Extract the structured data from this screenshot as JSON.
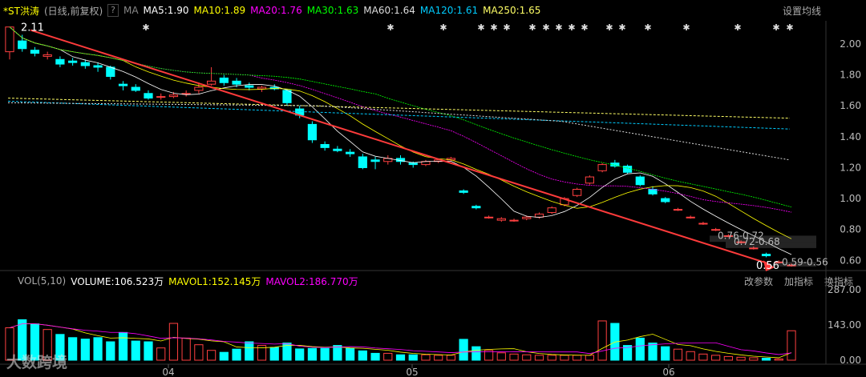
{
  "header": {
    "stock_name": "*ST洪涛",
    "period": "(日线,前复权)",
    "help": "?",
    "ma_label": "MA",
    "ma5": "MA5:1.90",
    "ma10": "MA10:1.89",
    "ma20": "MA20:1.76",
    "ma30": "MA30:1.63",
    "ma60": "MA60:1.64",
    "ma120": "MA120:1.61",
    "ma250": "MA250:1.65",
    "settings": "设置均线",
    "colors": {
      "ma5": "#ffffff",
      "ma10": "#ffff00",
      "ma20": "#ff00ff",
      "ma30": "#00ff00",
      "ma60": "#cccccc",
      "ma120": "#00ccff",
      "ma250": "#ffff66"
    }
  },
  "volume_header": {
    "label": "VOL(5,10)",
    "volume": "VOLUME:106.523万",
    "mavol1": "MAVOL1:152.145万",
    "mavol2": "MAVOL2:186.770万",
    "btn1": "改参数",
    "btn2": "加指标",
    "btn3": "换指标"
  },
  "annotations": {
    "high": "2.11",
    "low": "0.56",
    "label1": "0.76-0.72",
    "label2": "0.72-0.68",
    "label3": "0.59-0.56"
  },
  "watermark": "大数跨境",
  "chart_data": {
    "type": "candlestick",
    "price_ticks": [
      "2.00",
      "1.80",
      "1.60",
      "1.40",
      "1.20",
      "1.00",
      "0.80",
      "0.60"
    ],
    "price_range": [
      0.55,
      2.15
    ],
    "volume_ticks": [
      "287.00",
      "143.00",
      "0.00"
    ],
    "volume_range": [
      0,
      287
    ],
    "x_ticks": [
      "04",
      "05",
      "06"
    ],
    "candles": [
      [
        1.95,
        2.11,
        2.11,
        1.9
      ],
      [
        2.02,
        1.97,
        2.06,
        1.95
      ],
      [
        1.96,
        1.94,
        1.98,
        1.92
      ],
      [
        1.92,
        1.93,
        1.95,
        1.9
      ],
      [
        1.9,
        1.87,
        1.92,
        1.85
      ],
      [
        1.89,
        1.88,
        1.91,
        1.86
      ],
      [
        1.88,
        1.86,
        1.9,
        1.84
      ],
      [
        1.86,
        1.85,
        1.88,
        1.82
      ],
      [
        1.85,
        1.79,
        1.86,
        1.77
      ],
      [
        1.74,
        1.73,
        1.76,
        1.7
      ],
      [
        1.72,
        1.7,
        1.74,
        1.69
      ],
      [
        1.68,
        1.65,
        1.7,
        1.64
      ],
      [
        1.66,
        1.66,
        1.68,
        1.64
      ],
      [
        1.66,
        1.67,
        1.69,
        1.65
      ],
      [
        1.68,
        1.68,
        1.7,
        1.66
      ],
      [
        1.7,
        1.72,
        1.75,
        1.68
      ],
      [
        1.74,
        1.76,
        1.85,
        1.73
      ],
      [
        1.78,
        1.75,
        1.8,
        1.73
      ],
      [
        1.76,
        1.74,
        1.78,
        1.72
      ],
      [
        1.73,
        1.72,
        1.75,
        1.7
      ],
      [
        1.71,
        1.72,
        1.73,
        1.69
      ],
      [
        1.72,
        1.71,
        1.74,
        1.7
      ],
      [
        1.7,
        1.62,
        1.71,
        1.6
      ],
      [
        1.58,
        1.54,
        1.6,
        1.52
      ],
      [
        1.48,
        1.38,
        1.5,
        1.36
      ],
      [
        1.35,
        1.33,
        1.37,
        1.31
      ],
      [
        1.32,
        1.31,
        1.34,
        1.3
      ],
      [
        1.3,
        1.29,
        1.32,
        1.27
      ],
      [
        1.27,
        1.2,
        1.29,
        1.19
      ],
      [
        1.25,
        1.24,
        1.27,
        1.19
      ],
      [
        1.24,
        1.26,
        1.28,
        1.22
      ],
      [
        1.26,
        1.24,
        1.28,
        1.22
      ],
      [
        1.23,
        1.22,
        1.24,
        1.2
      ],
      [
        1.22,
        1.24,
        1.25,
        1.21
      ],
      [
        1.24,
        1.25,
        1.26,
        1.23
      ],
      [
        1.25,
        1.26,
        1.27,
        1.24
      ],
      [
        1.05,
        1.04,
        1.06,
        1.03
      ],
      [
        0.95,
        0.94,
        0.96,
        0.93
      ],
      [
        0.88,
        0.88,
        0.89,
        0.87
      ],
      [
        0.86,
        0.87,
        0.88,
        0.85
      ],
      [
        0.86,
        0.86,
        0.87,
        0.85
      ],
      [
        0.87,
        0.88,
        0.89,
        0.86
      ],
      [
        0.88,
        0.9,
        0.91,
        0.87
      ],
      [
        0.91,
        0.94,
        0.95,
        0.9
      ],
      [
        0.96,
        1.0,
        1.01,
        0.95
      ],
      [
        1.02,
        1.06,
        1.07,
        1.01
      ],
      [
        1.1,
        1.14,
        1.15,
        1.09
      ],
      [
        1.18,
        1.22,
        1.23,
        1.17
      ],
      [
        1.23,
        1.21,
        1.25,
        1.2
      ],
      [
        1.21,
        1.17,
        1.22,
        1.16
      ],
      [
        1.14,
        1.09,
        1.15,
        1.08
      ],
      [
        1.06,
        1.03,
        1.08,
        1.02
      ],
      [
        1.0,
        0.98,
        1.01,
        0.97
      ],
      [
        0.93,
        0.93,
        0.94,
        0.92
      ],
      [
        0.88,
        0.88,
        0.89,
        0.87
      ],
      [
        0.84,
        0.84,
        0.85,
        0.83
      ],
      [
        0.8,
        0.8,
        0.81,
        0.79
      ],
      [
        0.76,
        0.76,
        0.77,
        0.75
      ],
      [
        0.72,
        0.72,
        0.73,
        0.71
      ],
      [
        0.68,
        0.68,
        0.69,
        0.67
      ],
      [
        0.64,
        0.63,
        0.65,
        0.62
      ],
      [
        0.59,
        0.59,
        0.6,
        0.58
      ],
      [
        0.57,
        0.57,
        0.58,
        0.56
      ]
    ],
    "volumes": [
      132,
      165,
      148,
      125,
      105,
      92,
      86,
      92,
      75,
      113,
      78,
      75,
      50,
      150,
      90,
      63,
      40,
      32,
      45,
      75,
      60,
      52,
      70,
      46,
      48,
      48,
      60,
      48,
      38,
      28,
      28,
      22,
      22,
      22,
      20,
      20,
      85,
      55,
      40,
      30,
      25,
      22,
      20,
      20,
      20,
      20,
      20,
      160,
      150,
      60,
      90,
      70,
      55,
      45,
      35,
      25,
      20,
      15,
      12,
      10,
      8,
      5,
      120
    ]
  }
}
